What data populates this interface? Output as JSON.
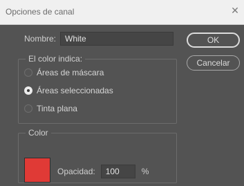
{
  "window": {
    "title": "Opciones de canal",
    "close_icon": "close-icon"
  },
  "name": {
    "label": "Nombre:",
    "value": "White"
  },
  "color_indicates": {
    "legend": "El color indica:",
    "options": [
      {
        "label": "Áreas de máscara",
        "checked": false
      },
      {
        "label": "Áreas seleccionadas",
        "checked": true
      },
      {
        "label": "Tinta plana",
        "checked": false
      }
    ]
  },
  "color": {
    "legend": "Color",
    "swatch": "#e03a36",
    "opacity_label": "Opacidad:",
    "opacity_value": "100",
    "opacity_unit": "%"
  },
  "buttons": {
    "ok": "OK",
    "cancel": "Cancelar"
  }
}
